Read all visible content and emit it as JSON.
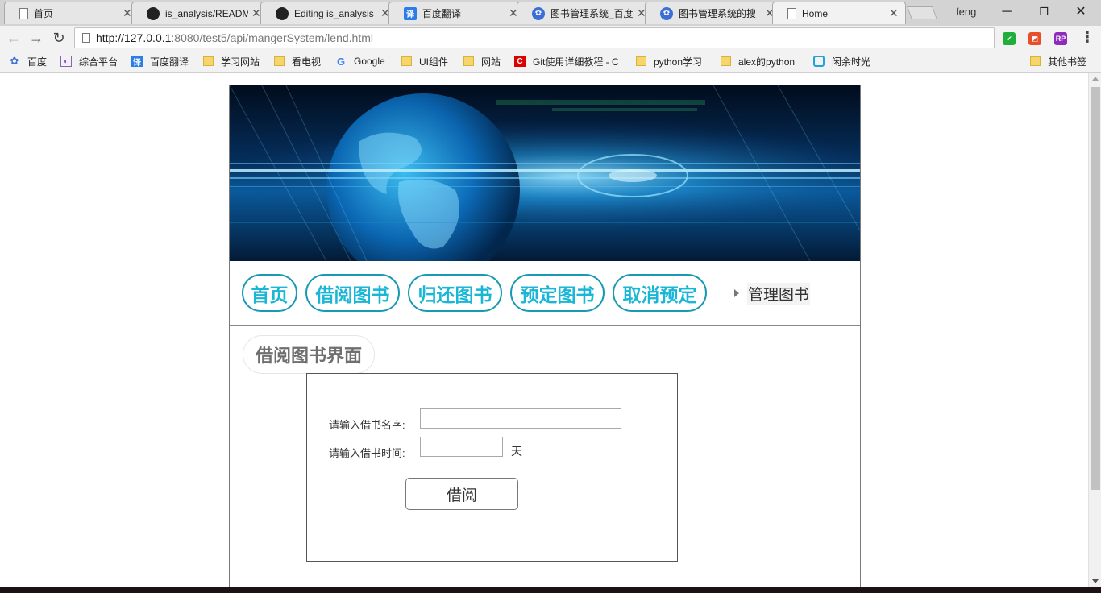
{
  "browser": {
    "tabs": [
      {
        "title": "首页",
        "favicon": "document-icon",
        "active": false
      },
      {
        "title": "is_analysis/READM",
        "favicon": "github-icon",
        "active": false
      },
      {
        "title": "Editing is_analysis",
        "favicon": "github-icon",
        "active": false
      },
      {
        "title": "百度翻译",
        "favicon": "baidu-translate-icon",
        "active": false
      },
      {
        "title": "图书管理系统_百度",
        "favicon": "baidu-paw-icon",
        "active": false
      },
      {
        "title": "图书管理系统的搜",
        "favicon": "baidu-paw-icon",
        "active": false
      },
      {
        "title": "Home",
        "favicon": "document-icon",
        "active": true
      }
    ],
    "user": "feng",
    "url_host": "http://127.0.0.1",
    "url_rest": ":8080/test5/api/mangerSystem/lend.html",
    "bookmarks": [
      {
        "label": "百度",
        "icon": "baidu-paw-icon"
      },
      {
        "label": "综合平台",
        "icon": "hub-icon"
      },
      {
        "label": "百度翻译",
        "icon": "baidu-translate-icon"
      },
      {
        "label": "学习网站",
        "icon": "folder-icon"
      },
      {
        "label": "看电视",
        "icon": "folder-icon"
      },
      {
        "label": "Google",
        "icon": "google-icon"
      },
      {
        "label": "UI组件",
        "icon": "folder-icon"
      },
      {
        "label": "网站",
        "icon": "folder-icon"
      },
      {
        "label": "Git使用详细教程 - C",
        "icon": "csdn-icon"
      },
      {
        "label": "python学习",
        "icon": "folder-icon"
      },
      {
        "label": "alex的python",
        "icon": "folder-icon"
      },
      {
        "label": "闲余时光",
        "icon": "bilibili-icon"
      },
      {
        "label": "其他书签",
        "icon": "folder-icon"
      }
    ]
  },
  "page": {
    "nav": {
      "home": "首页",
      "borrow": "借阅图书",
      "return": "归还图书",
      "reserve": "预定图书",
      "cancel_reserve": "取消预定",
      "manage": "管理图书"
    },
    "section_title": "借阅图书界面",
    "form": {
      "name_label": "请输入借书名字:",
      "name_value": "",
      "days_label": "请输入借书时间:",
      "days_value": "",
      "days_unit": "天",
      "submit": "借阅"
    }
  },
  "colors": {
    "nav_text": "#19b6d6",
    "nav_border": "#199ab3",
    "banner_dark": "#021428",
    "banner_light": "#1ea8e6"
  }
}
